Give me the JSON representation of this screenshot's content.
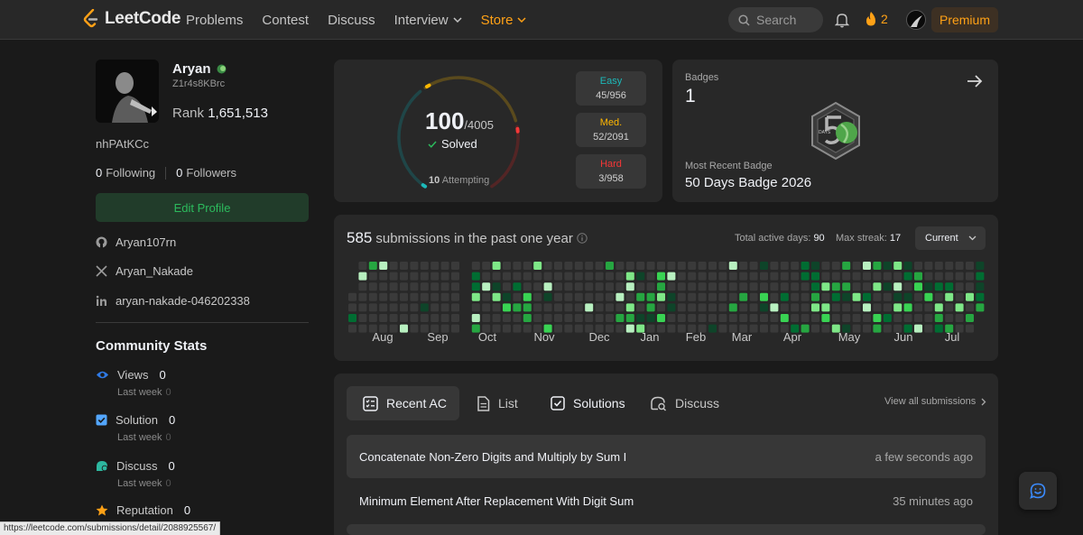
{
  "brand": {
    "name": "LeetCode",
    "accent": "#ffa116",
    "easy": "#1cbaba",
    "medium": "#ffb700",
    "hard": "#f63737",
    "green": "#2cbb5d"
  },
  "nav": {
    "links": [
      "Problems",
      "Contest",
      "Discuss",
      "Interview",
      "Store"
    ],
    "search_placeholder": "Search",
    "streak": "2",
    "premium": "Premium"
  },
  "profile": {
    "name": "Aryan",
    "id": "Z1r4s8KBrc",
    "rank_label": "Rank",
    "rank": "1,651,513",
    "handle": "nhPAtKCc",
    "following": "0",
    "following_label": "Following",
    "followers": "0",
    "followers_label": "Followers",
    "edit": "Edit Profile",
    "github": "Aryan107rn",
    "x": "Aryan_Nakade",
    "linkedin": "aryan-nakade-046202338"
  },
  "community": {
    "title": "Community Stats",
    "stats": [
      {
        "label": "Views",
        "value": "0",
        "sub": "Last week",
        "sub_value": "0"
      },
      {
        "label": "Solution",
        "value": "0",
        "sub": "Last week",
        "sub_value": "0"
      },
      {
        "label": "Discuss",
        "value": "0",
        "sub": "Last week",
        "sub_value": "0"
      },
      {
        "label": "Reputation",
        "value": "0"
      }
    ]
  },
  "progress": {
    "solved": "100",
    "total": "/4005",
    "solved_label": "Solved",
    "attempting_count": "10",
    "attempting_label": "Attempting",
    "easy_label": "Easy",
    "easy": "45/956",
    "med_label": "Med.",
    "med": "52/2091",
    "hard_label": "Hard",
    "hard": "3/958"
  },
  "badges": {
    "title": "Badges",
    "count": "1",
    "recent_label": "Most Recent Badge",
    "recent": "50 Days Badge 2026"
  },
  "heatmap": {
    "count": "585",
    "label": "submissions in the past one year",
    "active_label": "Total active days:",
    "active_days": "90",
    "streak_label": "Max streak:",
    "max_streak": "17",
    "selector": "Current",
    "months": [
      "Aug",
      "Sep",
      "Oct",
      "Nov",
      "Dec",
      "Jan",
      "Feb",
      "Mar",
      "Apr",
      "May",
      "Jun",
      "Jul"
    ]
  },
  "tabs": {
    "recent": "Recent AC",
    "list": "List",
    "solutions": "Solutions",
    "discuss": "Discuss",
    "view_all": "View all submissions"
  },
  "submissions": [
    {
      "title": "Concatenate Non-Zero Digits and Multiply by Sum I",
      "time": "a few seconds ago"
    },
    {
      "title": "Minimum Element After Replacement With Digit Sum",
      "time": "35 minutes ago"
    }
  ],
  "status_url": "https://leetcode.com/submissions/detail/2088925567/"
}
